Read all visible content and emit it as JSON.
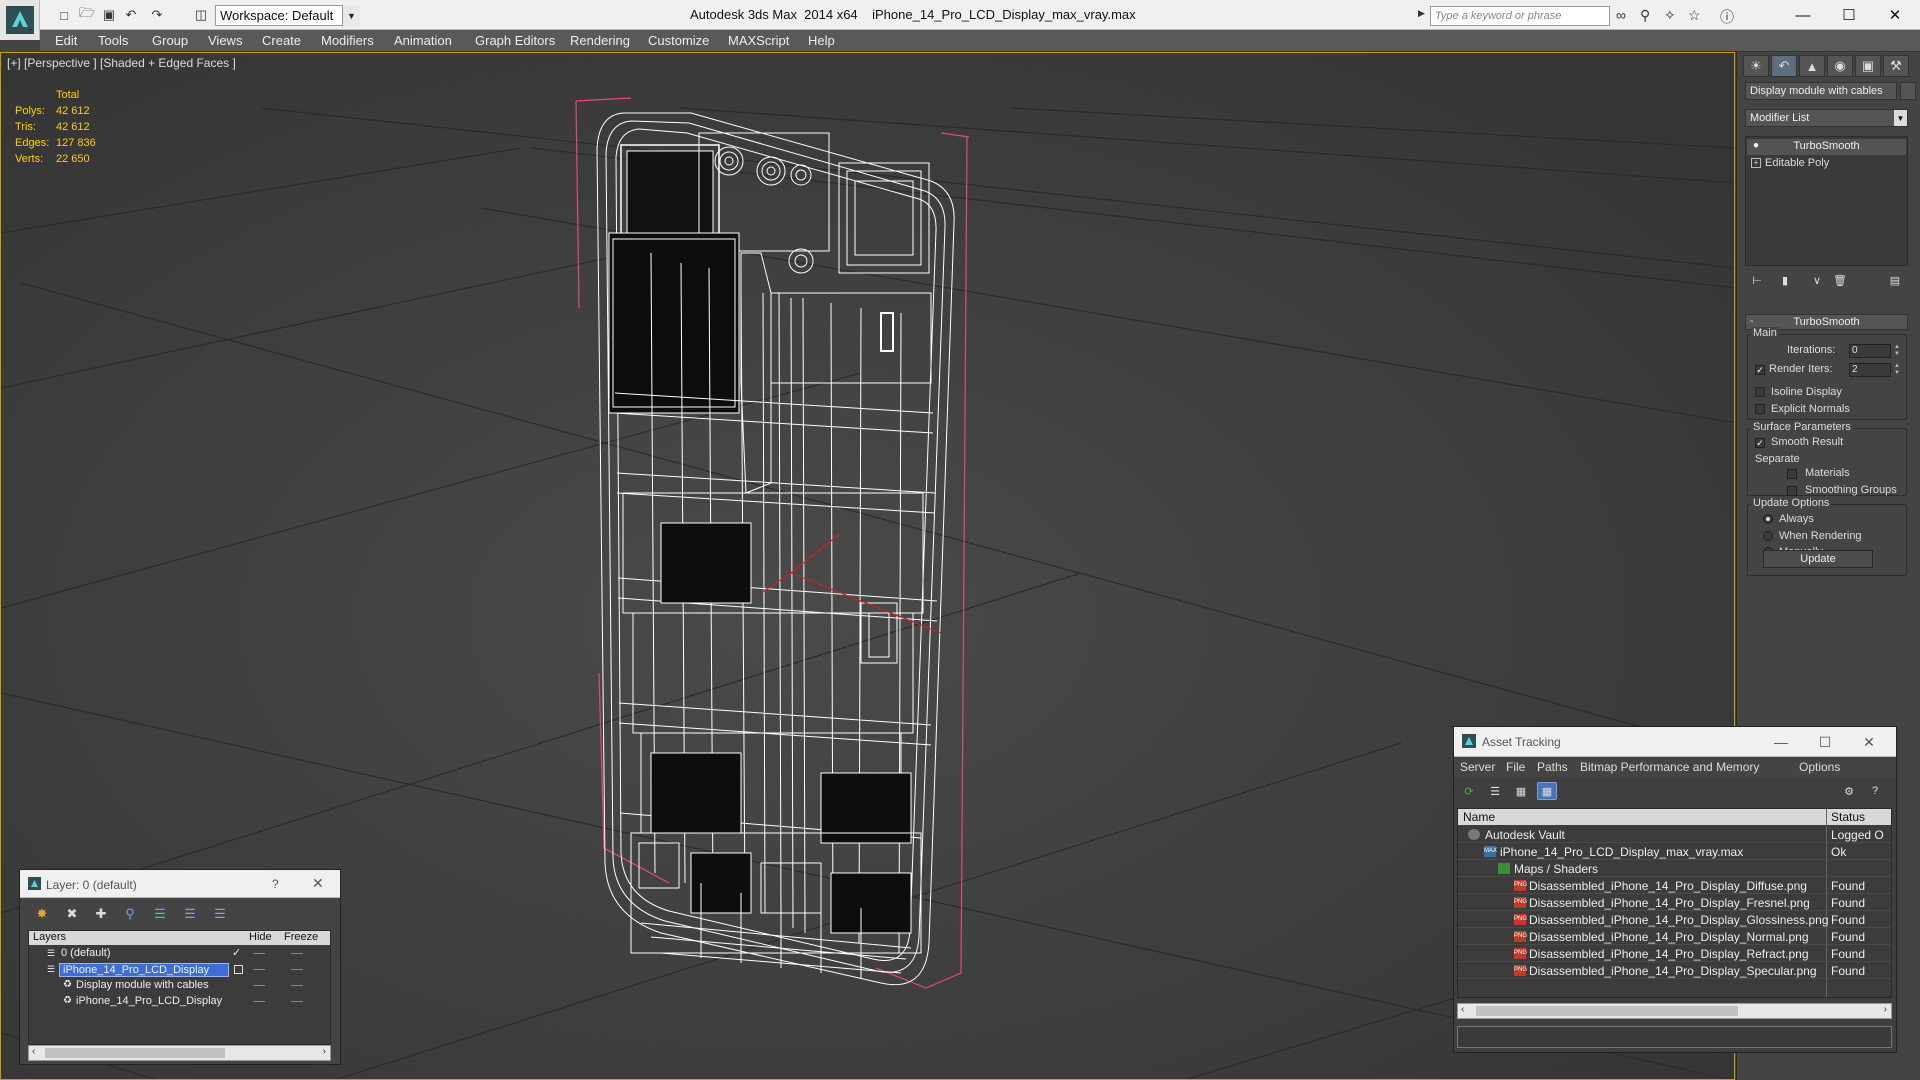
{
  "titlebar": {
    "workspace": "Workspace: Default",
    "app_title": "Autodesk 3ds Max  2014 x64",
    "file_title": "iPhone_14_Pro_LCD_Display_max_vray.max",
    "search_placeholder": "Type a keyword or phrase",
    "icons": [
      "new-file-icon",
      "open-icon",
      "save-icon",
      "undo-icon",
      "redo-icon",
      "project-icon",
      "binoculars-icon",
      "search-icon",
      "communication-icon",
      "favorites-icon",
      "help-icon"
    ]
  },
  "menubar": {
    "items": [
      "Edit",
      "Tools",
      "Group",
      "Views",
      "Create",
      "Modifiers",
      "Animation",
      "Graph Editors",
      "Rendering",
      "Customize",
      "MAXScript",
      "Help"
    ]
  },
  "viewport": {
    "label": "[+] [Perspective ] [Shaded + Edged Faces ]",
    "stats": {
      "header": "Total",
      "rows": [
        {
          "label": "Polys:",
          "value": "42 612"
        },
        {
          "label": "Tris:",
          "value": "42 612"
        },
        {
          "label": "Edges:",
          "value": "127 836"
        },
        {
          "label": "Verts:",
          "value": "22 650"
        }
      ]
    },
    "colors": {
      "background": "#414141",
      "grid": "#2a2a2a",
      "wire": "#ffffff",
      "bbox": "#e04a7a",
      "stats": "#ffd200"
    }
  },
  "command_panel": {
    "object_name": "Display module with cables",
    "modifier_list": "Modifier List",
    "stack": [
      {
        "label": "TurboSmooth",
        "icon": "lightbulb-icon"
      },
      {
        "label": "Editable Poly",
        "icon": "plus-box-icon"
      }
    ],
    "turbosmooth": {
      "title": "TurboSmooth",
      "main_label": "Main",
      "iterations_label": "Iterations:",
      "iterations_value": "0",
      "render_iters_label": "Render Iters:",
      "render_iters_value": "2",
      "render_iters_checked": true,
      "isoline_label": "Isoline Display",
      "explicit_normals_label": "Explicit Normals",
      "surface_label": "Surface Parameters",
      "smooth_result_label": "Smooth Result",
      "separate_label": "Separate",
      "materials_label": "Materials",
      "smoothing_groups_label": "Smoothing Groups",
      "update_options_label": "Update Options",
      "always_label": "Always",
      "when_rendering_label": "When Rendering",
      "manually_label": "Manually",
      "update_button": "Update"
    }
  },
  "asset_tracking": {
    "title": "Asset Tracking",
    "menu": [
      "Server",
      "File",
      "Paths",
      "Bitmap Performance and Memory",
      "Options"
    ],
    "columns": {
      "name": "Name",
      "status": "Status"
    },
    "rows": [
      {
        "name": "Autodesk Vault",
        "status": "Logged O",
        "icon": "vault-icon"
      },
      {
        "name": "iPhone_14_Pro_LCD_Display_max_vray.max",
        "status": "Ok",
        "icon": "max-file-icon"
      },
      {
        "name": "Maps / Shaders",
        "status": "",
        "icon": "maps-icon"
      },
      {
        "name": "Disassembled_iPhone_14_Pro_Display_Diffuse.png",
        "status": "Found",
        "icon": "png-icon"
      },
      {
        "name": "Disassembled_iPhone_14_Pro_Display_Fresnel.png",
        "status": "Found",
        "icon": "png-icon"
      },
      {
        "name": "Disassembled_iPhone_14_Pro_Display_Glossiness.png",
        "status": "Found",
        "icon": "png-icon"
      },
      {
        "name": "Disassembled_iPhone_14_Pro_Display_Normal.png",
        "status": "Found",
        "icon": "png-icon"
      },
      {
        "name": "Disassembled_iPhone_14_Pro_Display_Refract.png",
        "status": "Found",
        "icon": "png-icon"
      },
      {
        "name": "Disassembled_iPhone_14_Pro_Display_Specular.png",
        "status": "Found",
        "icon": "png-icon"
      }
    ]
  },
  "layers": {
    "title": "Layer: 0 (default)",
    "help": "?",
    "columns": {
      "layers": "Layers",
      "hide": "Hide",
      "freeze": "Freeze"
    },
    "rows": [
      {
        "name": "0 (default)"
      },
      {
        "name": "iPhone_14_Pro_LCD_Display"
      },
      {
        "name": "Display module with cables"
      },
      {
        "name": "iPhone_14_Pro_LCD_Display"
      }
    ]
  }
}
